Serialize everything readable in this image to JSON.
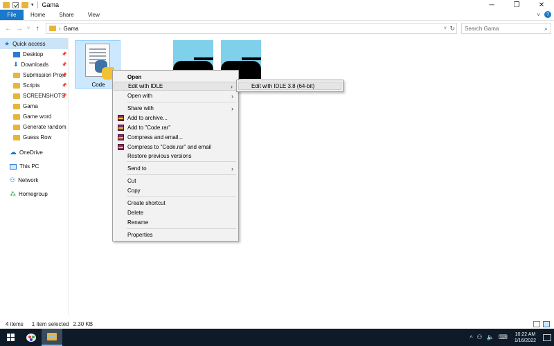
{
  "window": {
    "title": "Gama",
    "controls": {
      "minimize": "─",
      "maximize": "❐",
      "close": "✕"
    }
  },
  "ribbon": {
    "tabs": [
      "File",
      "Home",
      "Share",
      "View"
    ],
    "expand_icon": "˅",
    "help_icon": "?"
  },
  "address": {
    "back_icon": "←",
    "forward_icon": "→",
    "recent_icon": "˅",
    "up_icon": "↑",
    "chevron": "›",
    "path": "Gama",
    "dropdown_icon": "˅",
    "refresh_icon": "↻"
  },
  "search": {
    "placeholder": "Search Gama",
    "icon": "⌕"
  },
  "navpane": {
    "quick_access": "Quick access",
    "pinned": [
      {
        "label": "Desktop",
        "icon": "desktop-icon",
        "pinned": true
      },
      {
        "label": "Downloads",
        "icon": "downloads-icon",
        "pinned": true
      },
      {
        "label": "Submission Proje",
        "icon": "folder-icon",
        "pinned": true
      },
      {
        "label": "Scripts",
        "icon": "folder-icon",
        "pinned": true
      },
      {
        "label": "SCREENSHOTS",
        "icon": "folder-icon",
        "pinned": true
      },
      {
        "label": "Gama",
        "icon": "folder-icon",
        "pinned": false
      },
      {
        "label": "Game word",
        "icon": "folder-icon",
        "pinned": false
      },
      {
        "label": "Generate random n",
        "icon": "folder-icon",
        "pinned": false
      },
      {
        "label": "Guess Row",
        "icon": "folder-icon",
        "pinned": false
      }
    ],
    "pin_glyph": "📌",
    "onedrive": "OneDrive",
    "thispc": "This PC",
    "network": "Network",
    "homegroup": "Homegroup"
  },
  "files": {
    "code_label": "Code"
  },
  "context_menu": {
    "open": "Open",
    "edit_idle": "Edit with IDLE",
    "open_with": "Open with",
    "share_with": "Share with",
    "add_archive": "Add to archive...",
    "add_code_rar": "Add to \"Code.rar\"",
    "compress_email": "Compress and email...",
    "compress_code_email": "Compress to \"Code.rar\" and email",
    "restore": "Restore previous versions",
    "send_to": "Send to",
    "cut": "Cut",
    "copy": "Copy",
    "create_shortcut": "Create shortcut",
    "delete": "Delete",
    "rename": "Rename",
    "properties": "Properties",
    "arrow": "›"
  },
  "submenu": {
    "idle_38": "Edit with IDLE 3.8 (64-bit)"
  },
  "status": {
    "count": "4 items",
    "selected": "1 item selected",
    "size": "2.30 KB"
  },
  "taskbar": {
    "tray_chevron": "^",
    "tray_network": "⚇",
    "tray_volume": "🔈",
    "tray_keyboard": "⌨",
    "time": "10:22 AM",
    "date": "1/16/2022"
  }
}
